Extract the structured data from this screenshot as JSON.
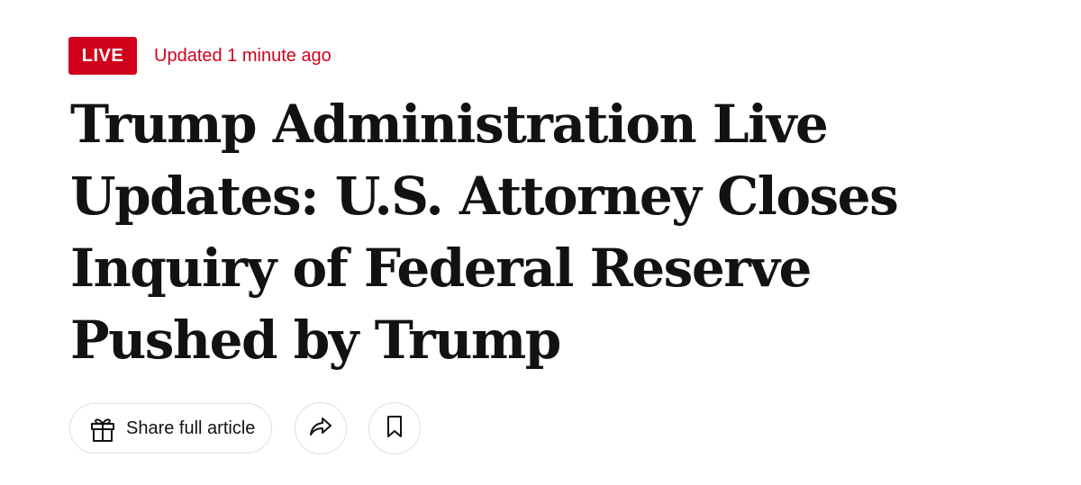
{
  "status": {
    "live_label": "LIVE",
    "updated_text": "Updated 1 minute ago",
    "accent_color": "#d0021b"
  },
  "headline": {
    "text": "Trump Administration Live Updates: U.S. Attorney Closes Inquiry of Federal Reserve Pushed by Trump"
  },
  "actions": {
    "share_label": "Share full article",
    "share_icon": "gift-icon",
    "forward_icon": "share-arrow-icon",
    "save_icon": "bookmark-icon"
  }
}
